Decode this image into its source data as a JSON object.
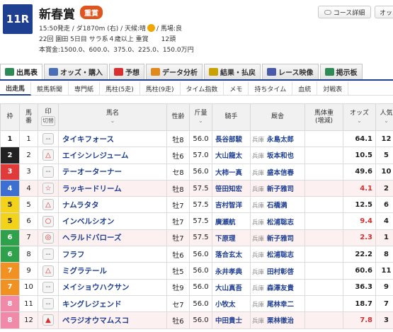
{
  "race": {
    "number": "11R",
    "name": "新春賞",
    "grade": "重賞",
    "line1_a": "15:50発走 / ダ1870m (右) / 天候:晴",
    "line1_b": "/ 馬場:良",
    "line2": "22回 園田 5日目 サラ系４歳以上 重賞　　12頭",
    "line3": "本賞金:1500.0、600.0、375.0、225.0、150.0万円"
  },
  "header_buttons": {
    "course": "コース詳細",
    "odds": "オッズ"
  },
  "tabs": [
    {
      "label": "出馬表",
      "icon": "table-icon",
      "color": "#2e8b57"
    },
    {
      "label": "オッズ・購入",
      "icon": "odds-icon",
      "color": "#4b6fb5"
    },
    {
      "label": "予想",
      "icon": "target-icon",
      "color": "#d83030"
    },
    {
      "label": "データ分析",
      "icon": "chart-icon",
      "color": "#e08a1e"
    },
    {
      "label": "結果・払戻",
      "icon": "result-icon",
      "color": "#c9a100"
    },
    {
      "label": "レース映像",
      "icon": "video-icon",
      "color": "#4a5aa8"
    },
    {
      "label": "掲示板",
      "icon": "board-icon",
      "color": "#2e8b57"
    }
  ],
  "subtabs": [
    "出走馬",
    "競馬新聞",
    "専門紙",
    "馬柱(5走)",
    "馬柱(9走)",
    "タイム指数",
    "メモ",
    "持ちタイム",
    "血統",
    "対戦表"
  ],
  "table_headers": {
    "waku": "枠",
    "umaban": "馬\n番",
    "mark": "印",
    "mark_sub": "切替",
    "name": "馬名",
    "sex": "性齢",
    "weight": "斤量",
    "jockey": "騎手",
    "trainer": "厩舎",
    "body": "馬体重\n(増減)",
    "odds": "オッズ",
    "pop": "人気"
  },
  "waku_colors": {
    "1": {
      "bg": "#ffffff",
      "fg": "#222"
    },
    "2": {
      "bg": "#222222",
      "fg": "#fff"
    },
    "3": {
      "bg": "#e03a3a",
      "fg": "#fff"
    },
    "4": {
      "bg": "#3c6fd1",
      "fg": "#fff"
    },
    "5": {
      "bg": "#f3d21a",
      "fg": "#222"
    },
    "6": {
      "bg": "#2fa14a",
      "fg": "#fff"
    },
    "7": {
      "bg": "#f09121",
      "fg": "#fff"
    },
    "8": {
      "bg": "#f18aa8",
      "fg": "#fff"
    }
  },
  "horses": [
    {
      "waku": "1",
      "umaban": "1",
      "mark": "--",
      "name": "タイキフォース",
      "sex": "牡8",
      "weight": "56.0",
      "jockey": "長谷部駿",
      "region": "兵庫",
      "trainer": "永島太郎",
      "body": "",
      "odds": "64.1",
      "pop": "12"
    },
    {
      "waku": "2",
      "umaban": "2",
      "mark": "△",
      "name": "エイシンレジューム",
      "sex": "牡6",
      "weight": "57.0",
      "jockey": "大山龍太",
      "region": "兵庫",
      "trainer": "坂本和也",
      "body": "",
      "odds": "10.5",
      "pop": "5"
    },
    {
      "waku": "3",
      "umaban": "3",
      "mark": "--",
      "name": "テーオーターナー",
      "sex": "セ8",
      "weight": "56.0",
      "jockey": "大柿一真",
      "region": "兵庫",
      "trainer": "盛本信春",
      "body": "",
      "odds": "49.6",
      "pop": "10"
    },
    {
      "waku": "4",
      "umaban": "4",
      "mark": "☆",
      "name": "ラッキードリーム",
      "sex": "牡8",
      "weight": "57.5",
      "jockey": "笹田知宏",
      "region": "兵庫",
      "trainer": "新子雅司",
      "body": "",
      "odds": "4.1",
      "pop": "2"
    },
    {
      "waku": "5",
      "umaban": "5",
      "mark": "△",
      "name": "ナムラタタ",
      "sex": "牡7",
      "weight": "57.5",
      "jockey": "吉村智洋",
      "region": "兵庫",
      "trainer": "石橋満",
      "body": "",
      "odds": "12.5",
      "pop": "6"
    },
    {
      "waku": "5",
      "umaban": "6",
      "mark": "○",
      "name": "インベルシオン",
      "sex": "牡7",
      "weight": "57.5",
      "jockey": "廣瀬航",
      "region": "兵庫",
      "trainer": "松浦聡志",
      "body": "",
      "odds": "9.4",
      "pop": "4"
    },
    {
      "waku": "6",
      "umaban": "7",
      "mark": "◎",
      "name": "ヘラルドバローズ",
      "sex": "牡7",
      "weight": "57.5",
      "jockey": "下原理",
      "region": "兵庫",
      "trainer": "新子雅司",
      "body": "",
      "odds": "2.3",
      "pop": "1"
    },
    {
      "waku": "6",
      "umaban": "8",
      "mark": "--",
      "name": "フラフ",
      "sex": "牡6",
      "weight": "56.0",
      "jockey": "落合玄太",
      "region": "兵庫",
      "trainer": "松浦聡志",
      "body": "",
      "odds": "22.2",
      "pop": "8"
    },
    {
      "waku": "7",
      "umaban": "9",
      "mark": "△",
      "name": "ミグラテール",
      "sex": "牡5",
      "weight": "56.0",
      "jockey": "永井孝典",
      "region": "兵庫",
      "trainer": "田村彰啓",
      "body": "",
      "odds": "60.6",
      "pop": "11"
    },
    {
      "waku": "7",
      "umaban": "10",
      "mark": "--",
      "name": "メイショウハクサン",
      "sex": "牡9",
      "weight": "56.0",
      "jockey": "大山真吾",
      "region": "兵庫",
      "trainer": "森澤友貴",
      "body": "",
      "odds": "36.3",
      "pop": "9"
    },
    {
      "waku": "8",
      "umaban": "11",
      "mark": "--",
      "name": "キングレジェンド",
      "sex": "セ7",
      "weight": "56.0",
      "jockey": "小牧太",
      "region": "兵庫",
      "trainer": "尾林幸二",
      "body": "",
      "odds": "18.7",
      "pop": "7"
    },
    {
      "waku": "8",
      "umaban": "12",
      "mark": "▲",
      "name": "ペラジオウマムスコ",
      "sex": "牡6",
      "weight": "56.0",
      "jockey": "中田貴士",
      "region": "兵庫",
      "trainer": "栗林徹治",
      "body": "",
      "odds": "7.8",
      "pop": "3"
    }
  ]
}
